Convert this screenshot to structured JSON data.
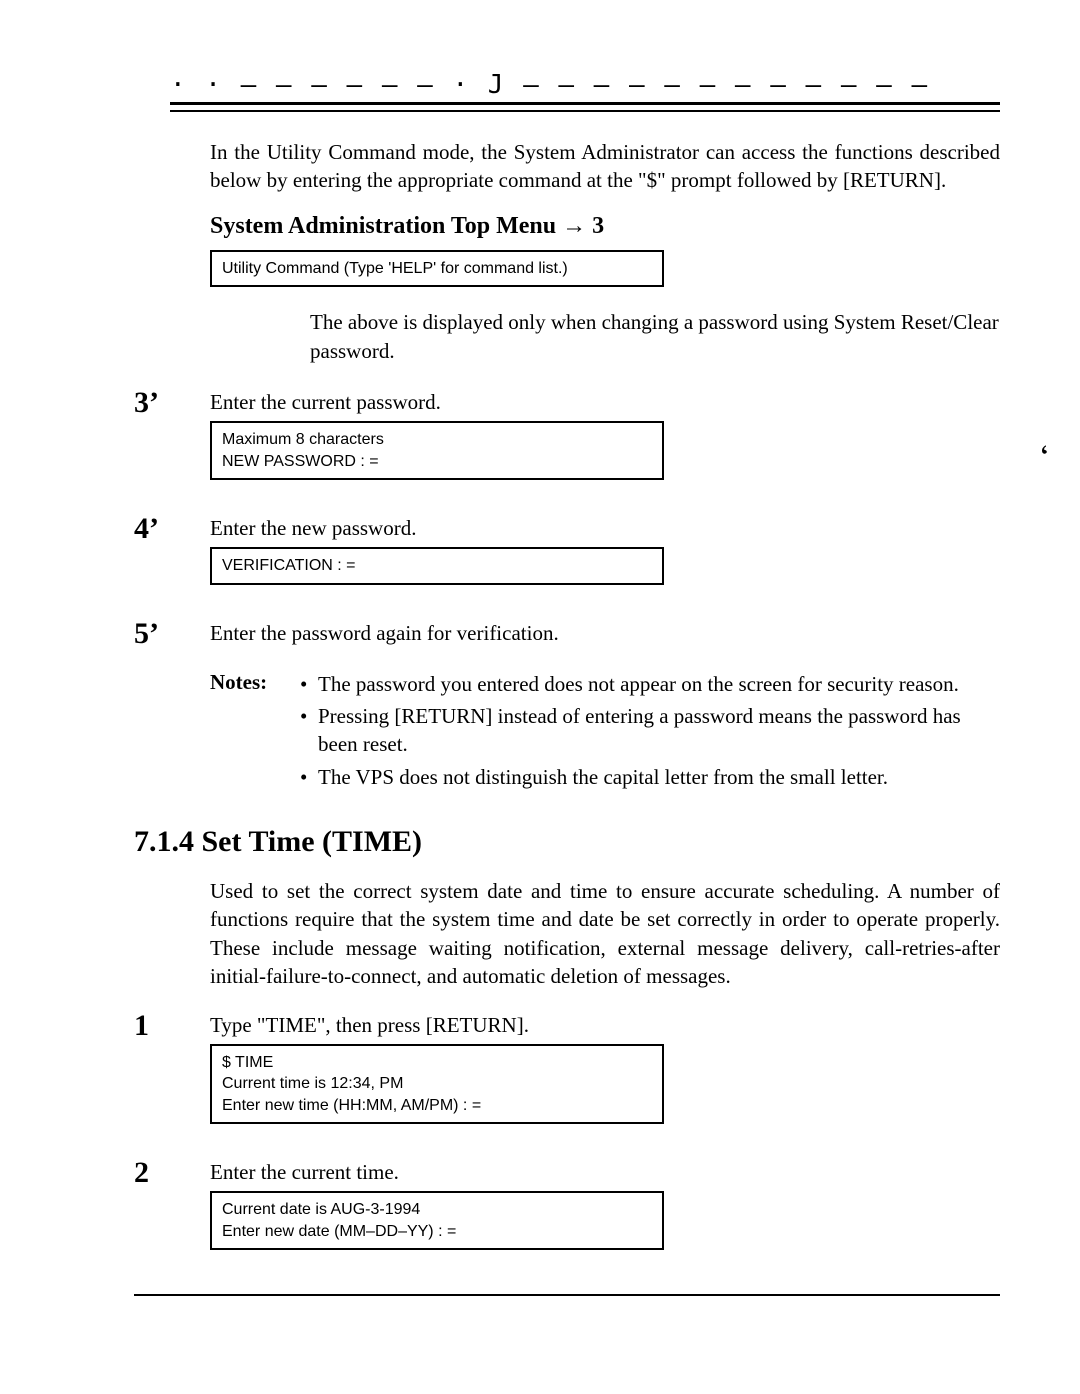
{
  "topDashes": "· · —    —  — — — — · J     —  — — — — — — — — —  — —",
  "intro": "In the Utility Command mode, the System Administrator can access the functions described below by entering the appropriate command at the \"$\" prompt followed by [RETURN].",
  "menuHeading": "System Administration Top Menu → 3",
  "utilityBox": "Utility Command (Type 'HELP' for command list.)",
  "displayedNote": "The above is displayed only when changing a password using System Reset/Clear password.",
  "steps_top": [
    {
      "num": "3’",
      "text": "Enter the current password.",
      "box": "Maximum 8 characters\nNEW PASSWORD : ="
    },
    {
      "num": "4’",
      "text": "Enter the new password.",
      "box": "VERIFICATION : ="
    },
    {
      "num": "5’",
      "text": "Enter the password again for verification.",
      "box": null
    }
  ],
  "notesLabel": "Notes:",
  "notes": [
    "The password you entered does not appear on the screen for security reason.",
    "Pressing [RETURN] instead of entering a password means the password has been reset.",
    "The VPS does not distinguish the capital letter from the small letter."
  ],
  "sectionTitle": "7.1.4  Set Time (TIME)",
  "timeIntro": "Used to set the correct system date and time to ensure accurate scheduling.  A number of functions require that the system time and date be set correctly in order to operate properly.  These include message waiting notification, external message delivery, call-retries-after initial-failure-to-connect, and automatic deletion of messages.",
  "steps_time": [
    {
      "num": "1",
      "text": "Type \"TIME\", then press [RETURN].",
      "box": "$ TIME\nCurrent time is 12:34, PM\n  Enter new time (HH:MM, AM/PM) : ="
    },
    {
      "num": "2",
      "text": "Enter the current time.",
      "box": "Current date is AUG-3-1994\n  Enter new date (MM–DD–YY) : ="
    }
  ],
  "strayMark": "‘"
}
